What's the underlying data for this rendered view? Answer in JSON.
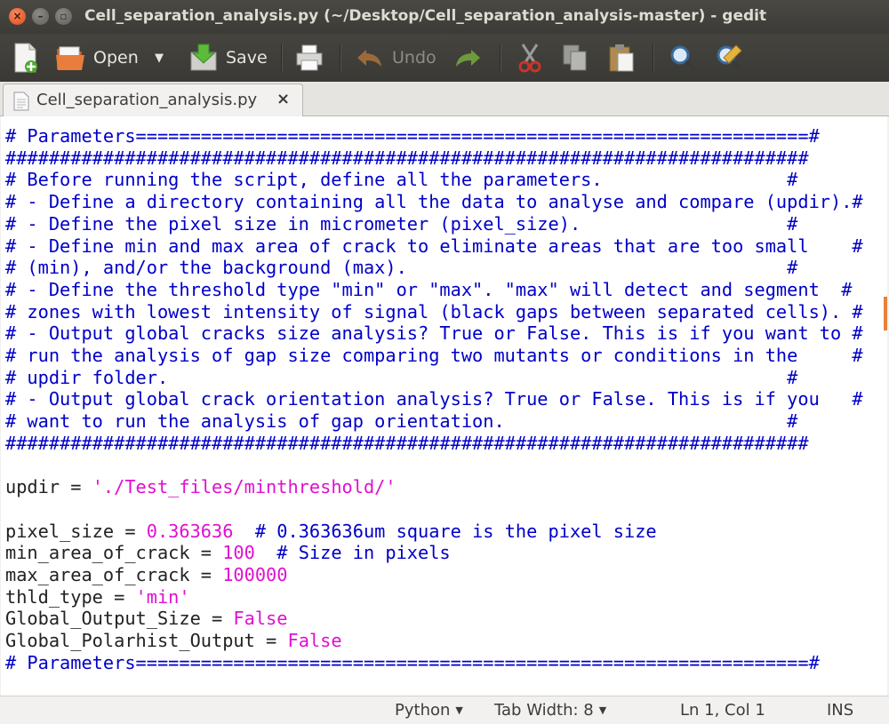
{
  "window": {
    "title": "Cell_separation_analysis.py (~/Desktop/Cell_separation_analysis-master) - gedit"
  },
  "toolbar": {
    "new_icon": "new-document-icon",
    "open_label": "Open",
    "save_label": "Save",
    "undo_label": "Undo",
    "icons": [
      "new-document-icon",
      "open-folder-icon",
      "chevron-down-icon",
      "save-icon",
      "print-icon",
      "undo-icon",
      "redo-icon",
      "cut-icon",
      "copy-icon",
      "paste-icon",
      "search-icon",
      "replace-icon"
    ]
  },
  "tab": {
    "title": "Cell_separation_analysis.py",
    "close": "×"
  },
  "editor": {
    "lines": [
      [
        [
          "cm",
          "# Parameters==============================================================#"
        ]
      ],
      [
        [
          "cm",
          "##########################################################################"
        ]
      ],
      [
        [
          "cm",
          "# Before running the script, define all the parameters.                 #"
        ]
      ],
      [
        [
          "cm",
          "# - Define a directory containing all the data to analyse and compare (updir).#"
        ]
      ],
      [
        [
          "cm",
          "# - Define the pixel size in micrometer (pixel_size).                   #"
        ]
      ],
      [
        [
          "cm",
          "# - Define min and max area of crack to eliminate areas that are too small    #"
        ]
      ],
      [
        [
          "cm",
          "# (min), and/or the background (max).                                   #"
        ]
      ],
      [
        [
          "cm",
          "# - Define the threshold type \"min\" or \"max\". \"max\" will detect and segment  #"
        ]
      ],
      [
        [
          "cm",
          "# zones with lowest intensity of signal (black gaps between separated cells). #"
        ]
      ],
      [
        [
          "cm",
          "# - Output global cracks size analysis? True or False. This is if you want to #"
        ]
      ],
      [
        [
          "cm",
          "# run the analysis of gap size comparing two mutants or conditions in the     #"
        ]
      ],
      [
        [
          "cm",
          "# updir folder.                                                         #"
        ]
      ],
      [
        [
          "cm",
          "# - Output global crack orientation analysis? True or False. This is if you   #"
        ]
      ],
      [
        [
          "cm",
          "# want to run the analysis of gap orientation.                          #"
        ]
      ],
      [
        [
          "cm",
          "##########################################################################"
        ]
      ],
      [
        [
          "plain",
          ""
        ]
      ],
      [
        [
          "plain",
          "updir = "
        ],
        [
          "str",
          "'./Test_files/minthreshold/'"
        ]
      ],
      [
        [
          "plain",
          ""
        ]
      ],
      [
        [
          "plain",
          "pixel_size = "
        ],
        [
          "num",
          "0.363636"
        ],
        [
          "plain",
          "  "
        ],
        [
          "cm",
          "# 0.363636um square is the pixel size"
        ]
      ],
      [
        [
          "plain",
          "min_area_of_crack = "
        ],
        [
          "num",
          "100"
        ],
        [
          "plain",
          "  "
        ],
        [
          "cm",
          "# Size in pixels"
        ]
      ],
      [
        [
          "plain",
          "max_area_of_crack = "
        ],
        [
          "num",
          "100000"
        ]
      ],
      [
        [
          "plain",
          "thld_type = "
        ],
        [
          "str",
          "'min'"
        ]
      ],
      [
        [
          "plain",
          "Global_Output_Size = "
        ],
        [
          "kw",
          "False"
        ]
      ],
      [
        [
          "plain",
          "Global_Polarhist_Output = "
        ],
        [
          "kw",
          "False"
        ]
      ],
      [
        [
          "cm",
          "# Parameters==============================================================#"
        ]
      ]
    ]
  },
  "statusbar": {
    "language": "Python",
    "tab_width": "Tab Width: 8",
    "position": "Ln 1, Col 1",
    "mode": "INS"
  },
  "colors": {
    "comment": "#0000c8",
    "literal": "#e010d0",
    "titlebar": "#3c3b37",
    "close_button": "#df4a16"
  }
}
